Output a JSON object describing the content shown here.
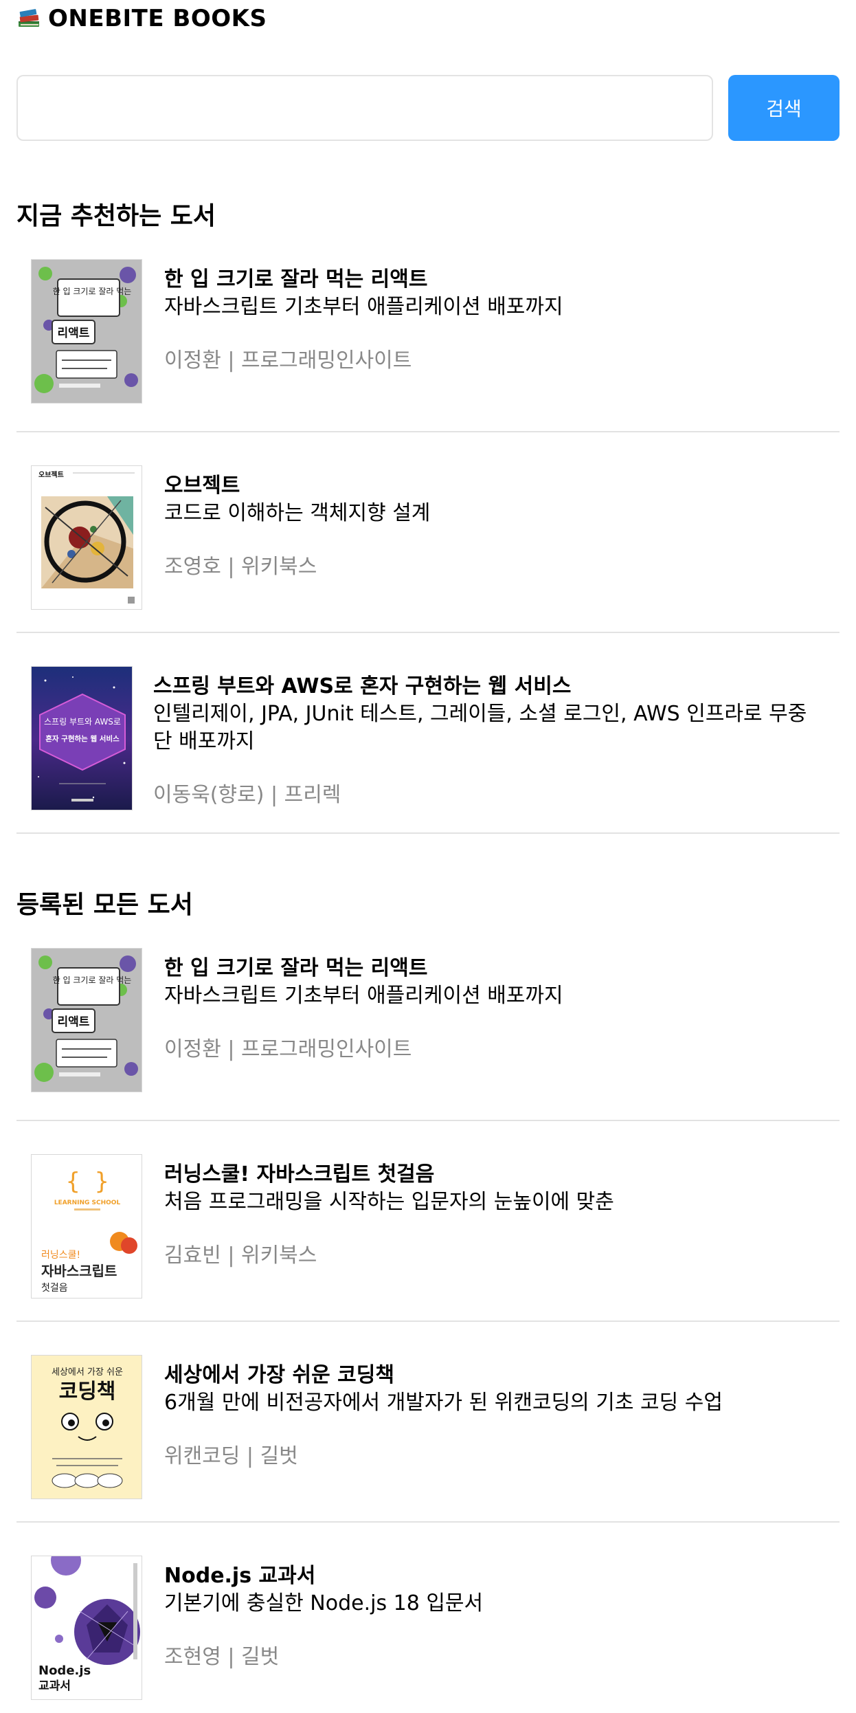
{
  "header": {
    "logo_icon": "books-icon",
    "title": "ONEBITE BOOKS"
  },
  "search": {
    "value": "",
    "placeholder": "",
    "button_label": "검색",
    "button_color": "#2b97ff"
  },
  "recommended": {
    "title": "지금 추천하는 도서",
    "books": [
      {
        "title": "한 입 크기로 잘라 먹는 리액트",
        "subtitle": "자바스크립트 기초부터 애플리케이션 배포까지",
        "author": "이정환 | 프로그래밍인사이트",
        "cover": "react-cover"
      },
      {
        "title": "오브젝트",
        "subtitle": "코드로 이해하는 객체지향 설계",
        "author": "조영호 | 위키북스",
        "cover": "object-cover"
      },
      {
        "title": "스프링 부트와 AWS로 혼자 구현하는 웹 서비스",
        "subtitle": "인텔리제이, JPA, JUnit 테스트, 그레이들, 소셜 로그인, AWS 인프라로 무중단 배포까지",
        "author": "이동욱(향로) | 프리렉",
        "cover": "spring-cover"
      }
    ]
  },
  "all": {
    "title": "등록된 모든 도서",
    "books": [
      {
        "title": "한 입 크기로 잘라 먹는 리액트",
        "subtitle": "자바스크립트 기초부터 애플리케이션 배포까지",
        "author": "이정환 | 프로그래밍인사이트",
        "cover": "react-cover"
      },
      {
        "title": "러닝스쿨! 자바스크립트 첫걸음",
        "subtitle": "처음 프로그래밍을 시작하는 입문자의 눈높이에 맞춘",
        "author": "김효빈 | 위키북스",
        "cover": "learning-js-cover"
      },
      {
        "title": "세상에서 가장 쉬운 코딩책",
        "subtitle": "6개월 만에 비전공자에서 개발자가 된 위캔코딩의 기초 코딩 수업",
        "author": "위캔코딩 | 길벗",
        "cover": "easy-coding-cover"
      },
      {
        "title": "Node.js 교과서",
        "subtitle": "기본기에 충실한 Node.js 18 입문서",
        "author": "조현영 | 길벗",
        "cover": "nodejs-cover"
      }
    ]
  },
  "covers": {
    "react": {
      "label_top": "한 입 크기로 잘라 먹는",
      "label_main": "리액트"
    },
    "object": {
      "label": "오브젝트"
    },
    "spring": {
      "label_top": "스프링 부트와 AWS로",
      "label_main": "혼자 구현하는 웹 서비스"
    },
    "learning": {
      "label_top": "LEARNING SCHOOL",
      "label_main": "자바스크립트",
      "label_sub": "첫걸음"
    },
    "easy": {
      "label_top": "세상에서 가장 쉬운",
      "label_main": "코딩책"
    },
    "node": {
      "label_main": "Node.js",
      "label_sub": "교과서"
    }
  }
}
